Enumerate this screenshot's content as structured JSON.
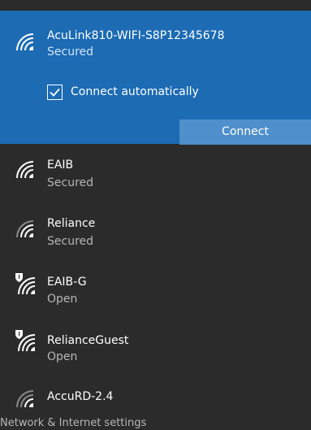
{
  "selected_network": {
    "ssid": "AcuLink810-WIFI-S8P12345678",
    "status": "Secured",
    "icon": "wifi-signal-icon",
    "auto_connect_label": "Connect automatically",
    "auto_connect_checked": true,
    "connect_label": "Connect"
  },
  "networks": [
    {
      "ssid": "EAIB",
      "status": "Secured",
      "icon": "wifi-signal-icon"
    },
    {
      "ssid": "Reliance",
      "status": "Secured",
      "icon": "wifi-signal-icon"
    },
    {
      "ssid": "EAIB-G",
      "status": "Open",
      "icon": "wifi-open-shield-icon"
    },
    {
      "ssid": "RelianceGuest",
      "status": "Open",
      "icon": "wifi-open-shield-icon"
    },
    {
      "ssid": "AccuRD-2.4",
      "status": "",
      "icon": "wifi-signal-icon"
    }
  ],
  "footer": {
    "settings_label": "Network & Internet settings"
  },
  "colors": {
    "accent": "#1c6bb3",
    "button": "#4f8fcb",
    "background": "#2b2b2b",
    "secondary_text": "#b7b7b7"
  }
}
